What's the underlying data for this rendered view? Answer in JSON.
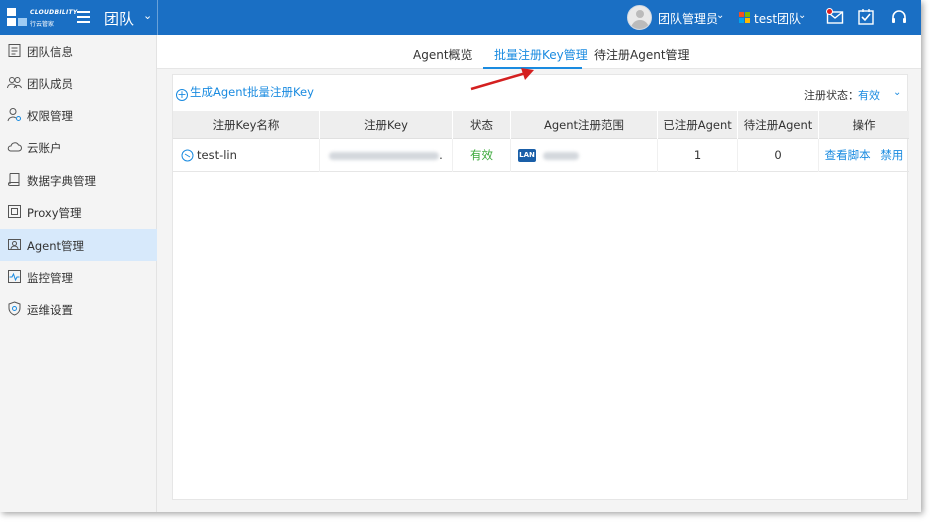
{
  "topbar": {
    "logo_text": "CLOUDBILITY",
    "logo_subtext": "行云管家",
    "team_title": "团队",
    "user_name": "团队管理员",
    "org_name": "test团队",
    "icons": [
      "menu-icon",
      "mail-icon",
      "task-icon",
      "headset-icon"
    ]
  },
  "sidebar": {
    "items": [
      {
        "label": "团队信息",
        "icon": "info-icon"
      },
      {
        "label": "团队成员",
        "icon": "members-icon"
      },
      {
        "label": "权限管理",
        "icon": "permission-icon"
      },
      {
        "label": "云账户",
        "icon": "cloud-icon"
      },
      {
        "label": "数据字典管理",
        "icon": "dictionary-icon"
      },
      {
        "label": "Proxy管理",
        "icon": "proxy-icon"
      },
      {
        "label": "Agent管理",
        "icon": "agent-icon",
        "active": true
      },
      {
        "label": "监控管理",
        "icon": "monitor-icon"
      },
      {
        "label": "运维设置",
        "icon": "ops-settings-icon"
      }
    ]
  },
  "tabs": [
    {
      "label": "Agent概览"
    },
    {
      "label": "批量注册Key管理",
      "active": true
    },
    {
      "label": "待注册Agent管理"
    }
  ],
  "toolbar": {
    "generate_link": "生成Agent批量注册Key",
    "status_filter_label": "注册状态：",
    "status_filter_value": "有效"
  },
  "table": {
    "columns": [
      "注册Key名称",
      "注册Key",
      "状态",
      "Agent注册范围",
      "已注册Agent",
      "待注册Agent",
      "操作"
    ],
    "rows": [
      {
        "name": "test-lin",
        "key_suffix": ".",
        "status": "有效",
        "scope_badge": "LAN",
        "registered": "1",
        "pending": "0",
        "actions": [
          "查看脚本",
          "禁用"
        ]
      }
    ]
  },
  "colors": {
    "topbar": "#1a6fc4",
    "accent": "#1a8be0",
    "active_sidebar": "#d7e9fb",
    "status_valid": "#3aa83a",
    "annotation_arrow": "#d42020"
  }
}
